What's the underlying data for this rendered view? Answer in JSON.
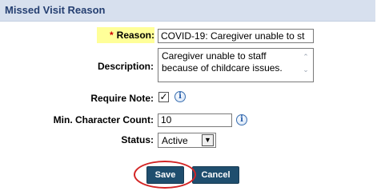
{
  "header": {
    "title": "Missed Visit Reason"
  },
  "form": {
    "reason": {
      "required_mark": "*",
      "label": "Reason:",
      "value": "COVID-19: Caregiver unable to st"
    },
    "description": {
      "label": "Description:",
      "value": "Caregiver unable to staff because of childcare issues."
    },
    "require_note": {
      "label": "Require Note:",
      "checked_glyph": "✓",
      "info_glyph": "i"
    },
    "min_char_count": {
      "label": "Min. Character Count:",
      "value": "10",
      "info_glyph": "i"
    },
    "status": {
      "label": "Status:",
      "value": "Active",
      "arrow_glyph": "▼"
    }
  },
  "buttons": {
    "save_label": "Save",
    "cancel_label": "Cancel"
  },
  "colors": {
    "header_bg": "#d7e0ee",
    "header_text": "#253f71",
    "required_highlight": "#ffff99",
    "button_bg": "#1f4e6e",
    "annotation_ellipse": "#d32424"
  }
}
